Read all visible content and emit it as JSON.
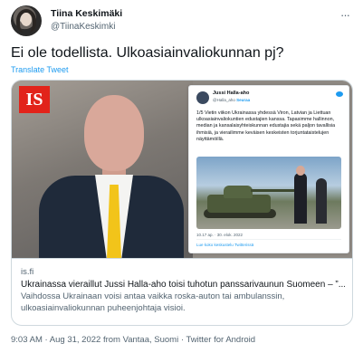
{
  "author": {
    "display_name": "Tiina Keskimäki",
    "handle": "@TiinaKeskimki",
    "more_label": "···"
  },
  "tweet": {
    "text": "Ei ole todellista. Ulkoasiainvaliokunnan pj?",
    "translate_label": "Translate Tweet"
  },
  "card": {
    "logo_text": "IS",
    "domain": "is.fi",
    "title": "Ukrainassa vieraillut Jussi Halla-aho toisi tuhotun panssarivaunun Suomeen – ”...",
    "description": "Vaihdossa Ukrainaan voisi antaa vaikka roska-auton tai ambulanssin, ulkoasiainvaliokunnan puheenjohtaja visioi.",
    "embedded_tweet": {
      "name": "Jussi Halla-aho",
      "handle": "@Halla_aho",
      "follow": "Seuraa",
      "text": "1/5 Vietin viikon Ukrainassa yhdessä Viron, Latvian ja Liettuan ulkoasiainvaliokuntien edustajien kanssa. Tapasimme hallinnon, median ja kansalaisyhteiskunnan edustajia sekä paljon tavallisia ihmisiä, ja vierailimme keväisen keskeisten torjuntataistelujen näyttämöillä.",
      "time": "10.17 ap. · 30. elok. 2022",
      "likes": "Lue koko keskustelu Twitterissä"
    }
  },
  "meta": {
    "time": "9:03 AM",
    "sep1": " · ",
    "date": "Aug 31, 2022",
    "from_prefix": " from ",
    "location": "Vantaa, Suomi",
    "sep2": " · ",
    "source": "Twitter for Android"
  }
}
